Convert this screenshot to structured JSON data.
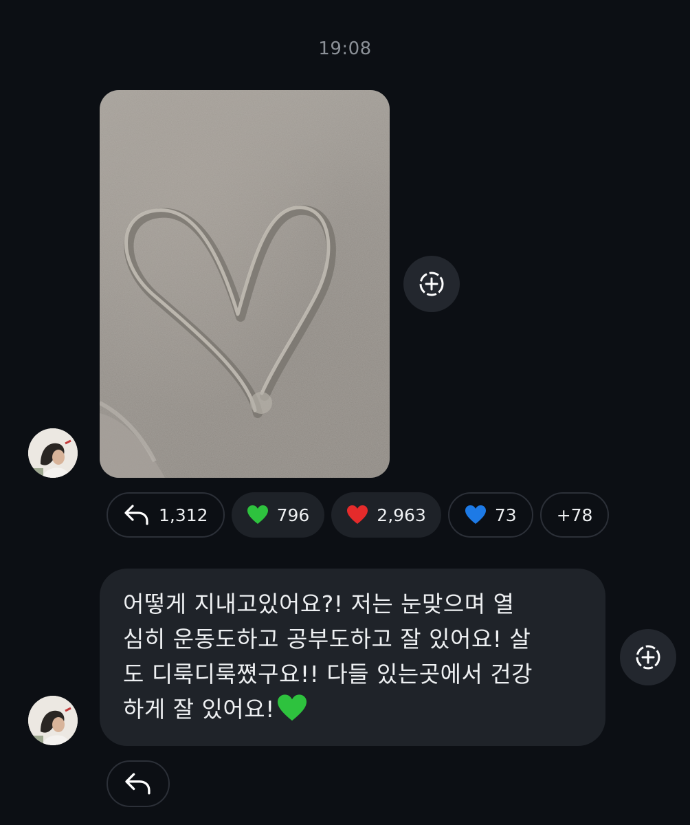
{
  "timestamp": "19:08",
  "photo_message": {
    "image_icon": "heart-in-sand-photo"
  },
  "share_icon": "dashed-circle-plus-icon",
  "reactions": [
    {
      "icon": "reply-arrow-icon",
      "count": "1,312"
    },
    {
      "icon": "green-heart-icon",
      "count": "796",
      "color": "#2ec23e"
    },
    {
      "icon": "red-heart-icon",
      "count": "2,963",
      "color": "#e52b2b"
    },
    {
      "icon": "blue-heart-icon",
      "count": "73",
      "color": "#1d7ae6"
    },
    {
      "icon": "",
      "count": "+78"
    }
  ],
  "text_message": {
    "line1": "어떻게 지내고있어요?! 저는 눈맞으며 열",
    "line2": "심히 운동도하고 공부도하고 잘 있어요! 살",
    "line3": "도 디룩디룩쪘구요!! 다들 있는곳에서 건강",
    "line4": "하게 잘 있어요!",
    "trailing_emoji": "green-heart-icon"
  },
  "colors": {
    "background": "#0c0f14",
    "bubble": "#1f2329",
    "timestamp": "#8b9097"
  }
}
